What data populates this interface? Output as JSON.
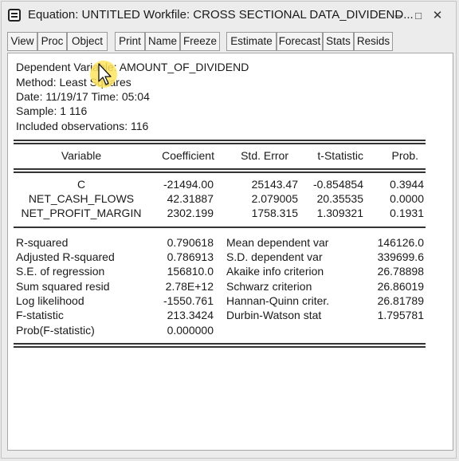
{
  "window": {
    "title": "Equation: UNTITLED   Workfile: CROSS SECTIONAL DATA_DIVIDEND...",
    "controls": {
      "minimize": "–",
      "maximize": "□",
      "close": "✕"
    }
  },
  "toolbar": {
    "buttons": [
      "View",
      "Proc",
      "Object",
      "Print",
      "Name",
      "Freeze",
      "Estimate",
      "Forecast",
      "Stats",
      "Resids"
    ]
  },
  "header": {
    "dependent_label": "Dependent Variable: ",
    "dependent_value": "AMOUNT_OF_DIVIDEND",
    "method": "Method: Least Squares",
    "date": "Date: 11/19/17   Time: 05:04",
    "sample": "Sample: 1 116",
    "observations": "Included observations: 116"
  },
  "coef_table": {
    "headers": {
      "variable": "Variable",
      "coefficient": "Coefficient",
      "std_error": "Std. Error",
      "t_stat": "t-Statistic",
      "prob": "Prob."
    },
    "rows": [
      {
        "variable": "C",
        "coefficient": "-21494.00",
        "std_error": "25143.47",
        "t_stat": "-0.854854",
        "prob": "0.3944"
      },
      {
        "variable": "NET_CASH_FLOWS",
        "coefficient": "42.31887",
        "std_error": "2.079005",
        "t_stat": "20.35535",
        "prob": "0.0000"
      },
      {
        "variable": "NET_PROFIT_MARGIN",
        "coefficient": "2302.199",
        "std_error": "1758.315",
        "t_stat": "1.309321",
        "prob": "0.1931"
      }
    ]
  },
  "stats": {
    "left": [
      {
        "label": "R-squared",
        "value": "0.790618"
      },
      {
        "label": "Adjusted R-squared",
        "value": "0.786913"
      },
      {
        "label": "S.E. of regression",
        "value": "156810.0"
      },
      {
        "label": "Sum squared resid",
        "value": "2.78E+12"
      },
      {
        "label": "Log likelihood",
        "value": "-1550.761"
      },
      {
        "label": "F-statistic",
        "value": "213.3424"
      },
      {
        "label": "Prob(F-statistic)",
        "value": "0.000000"
      }
    ],
    "right": [
      {
        "label": "Mean dependent var",
        "value": "146126.0"
      },
      {
        "label": "S.D. dependent var",
        "value": "339699.6"
      },
      {
        "label": "Akaike info criterion",
        "value": "26.78898"
      },
      {
        "label": "Schwarz criterion",
        "value": "26.86019"
      },
      {
        "label": "Hannan-Quinn criter.",
        "value": "26.81789"
      },
      {
        "label": "Durbin-Watson stat",
        "value": "1.795781"
      }
    ]
  }
}
